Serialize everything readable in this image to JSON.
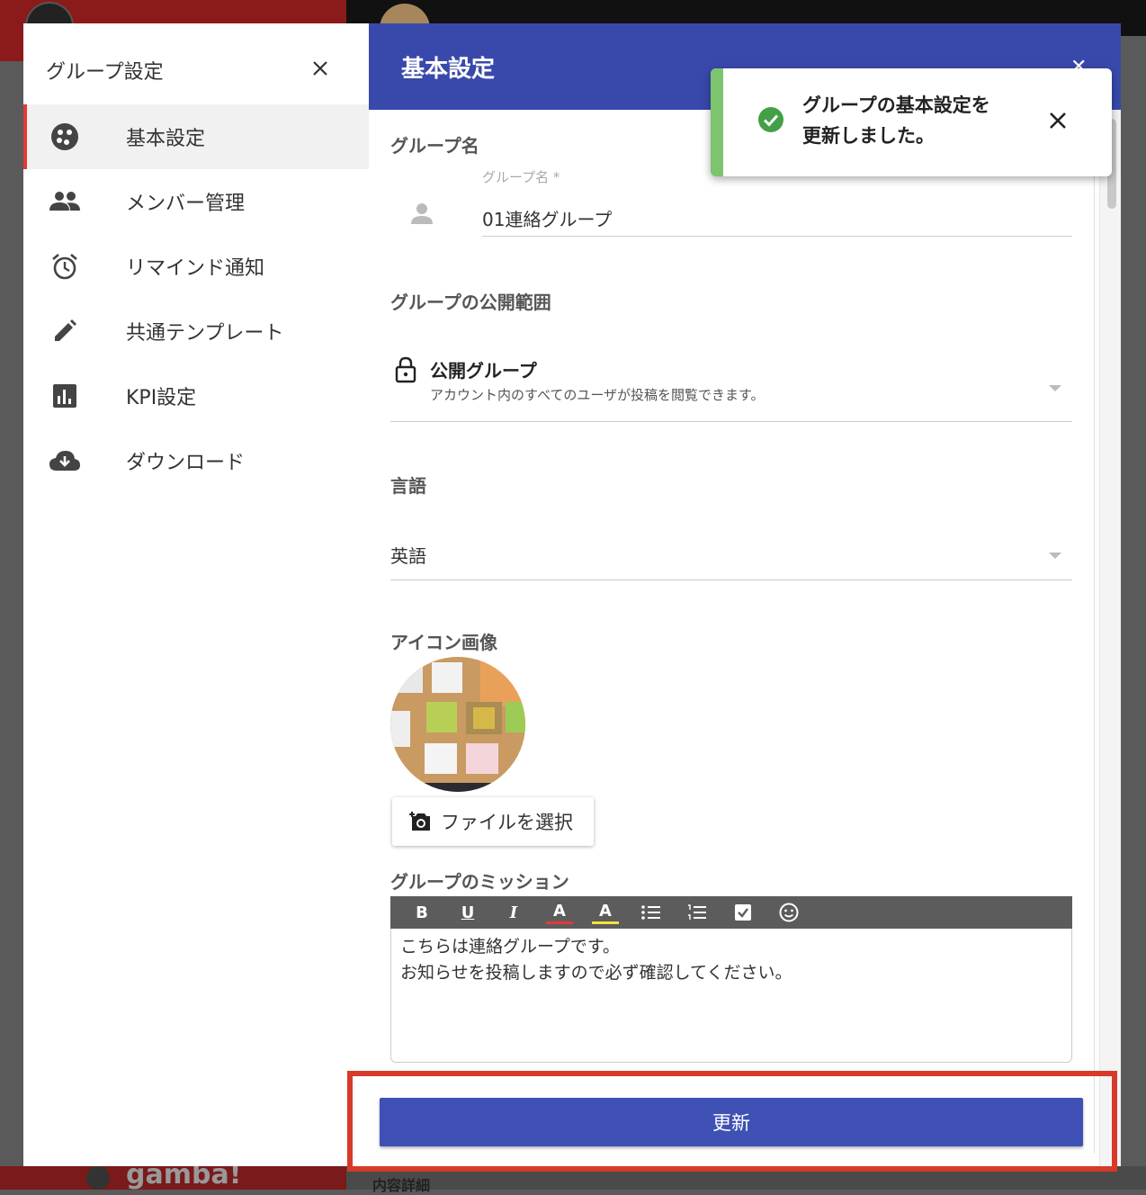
{
  "background": {
    "brand": "gamba!",
    "bottom_text": "内容詳細"
  },
  "sidebar": {
    "title": "グループ設定",
    "items": [
      {
        "label": "基本設定",
        "icon": "palette-icon",
        "active": true
      },
      {
        "label": "メンバー管理",
        "icon": "people-icon",
        "active": false
      },
      {
        "label": "リマインド通知",
        "icon": "alarm-icon",
        "active": false
      },
      {
        "label": "共通テンプレート",
        "icon": "pencil-icon",
        "active": false
      },
      {
        "label": "KPI設定",
        "icon": "bar-chart-icon",
        "active": false
      },
      {
        "label": "ダウンロード",
        "icon": "cloud-download-icon",
        "active": false
      }
    ]
  },
  "main": {
    "title": "基本設定",
    "group_name": {
      "section_label": "グループ名",
      "field_label": "グループ名 *",
      "value": "01連絡グループ"
    },
    "scope": {
      "section_label": "グループの公開範囲",
      "selected_title": "公開グループ",
      "selected_desc": "アカウント内のすべてのユーザが投稿を閲覧できます。"
    },
    "language": {
      "section_label": "言語",
      "selected": "英語"
    },
    "icon_image": {
      "section_label": "アイコン画像",
      "file_button": "ファイルを選択"
    },
    "mission": {
      "section_label": "グループのミッション",
      "toolbar": {
        "bold": "B",
        "underline": "U",
        "italic": "I",
        "font_color": "A",
        "highlight": "A"
      },
      "lines": [
        "こちらは連絡グループです。",
        "お知らせを投稿しますので必ず確認してください。"
      ]
    },
    "update_button": "更新"
  },
  "toast": {
    "message_line1": "グループの基本設定を",
    "message_line2": "更新しました。"
  },
  "colors": {
    "header": "#3949ab",
    "button": "#3f51b5",
    "active_indicator": "#e53935",
    "highlight_outline": "#d63a2a",
    "success": "#43a047"
  }
}
